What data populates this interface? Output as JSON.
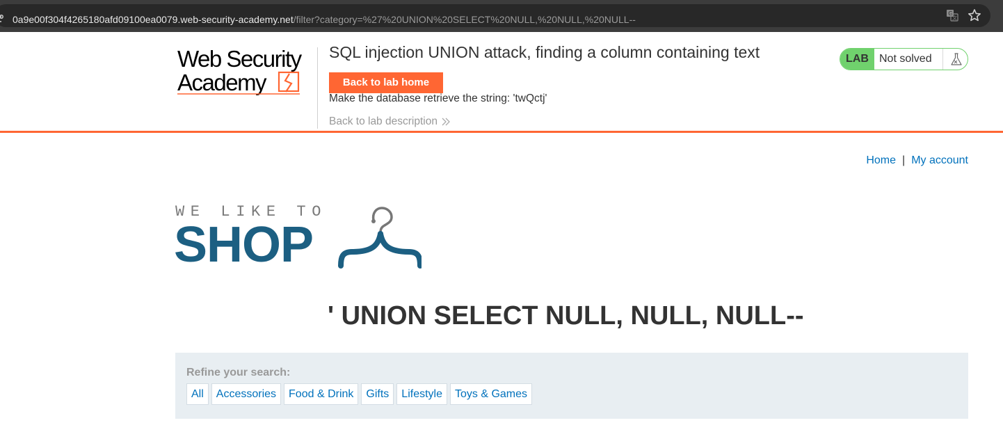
{
  "browser": {
    "url_host": "0a9e00f304f4265180afd09100ea0079.web-security-academy.net",
    "url_path": "/filter?category=%27%20UNION%20SELECT%20NULL,%20NULL,%20NULL--",
    "icons": [
      "site-info-icon",
      "translate-icon",
      "star-icon"
    ]
  },
  "academy": {
    "logo_line1": "Web Security",
    "logo_line2": "Academy",
    "lab_title": "SQL injection UNION attack, finding a column containing text",
    "back_home_label": "Back to lab home",
    "objective": "Make the database retrieve the string: 'twQctj'",
    "back_description_label": "Back to lab description",
    "lab_badge": "LAB",
    "lab_status": "Not solved",
    "brand_color": "#ff6633",
    "status_color": "#70d16d"
  },
  "nav": {
    "home": "Home",
    "separator": "|",
    "my_account": "My account"
  },
  "shop_logo": {
    "tagline": "WE LIKE TO",
    "word": "SHOP",
    "color": "#1c5f82"
  },
  "results_heading": "' UNION SELECT NULL, NULL, NULL--",
  "filters": {
    "label": "Refine your search:",
    "categories": [
      "All",
      "Accessories",
      "Food & Drink",
      "Gifts",
      "Lifestyle",
      "Toys & Games"
    ]
  }
}
